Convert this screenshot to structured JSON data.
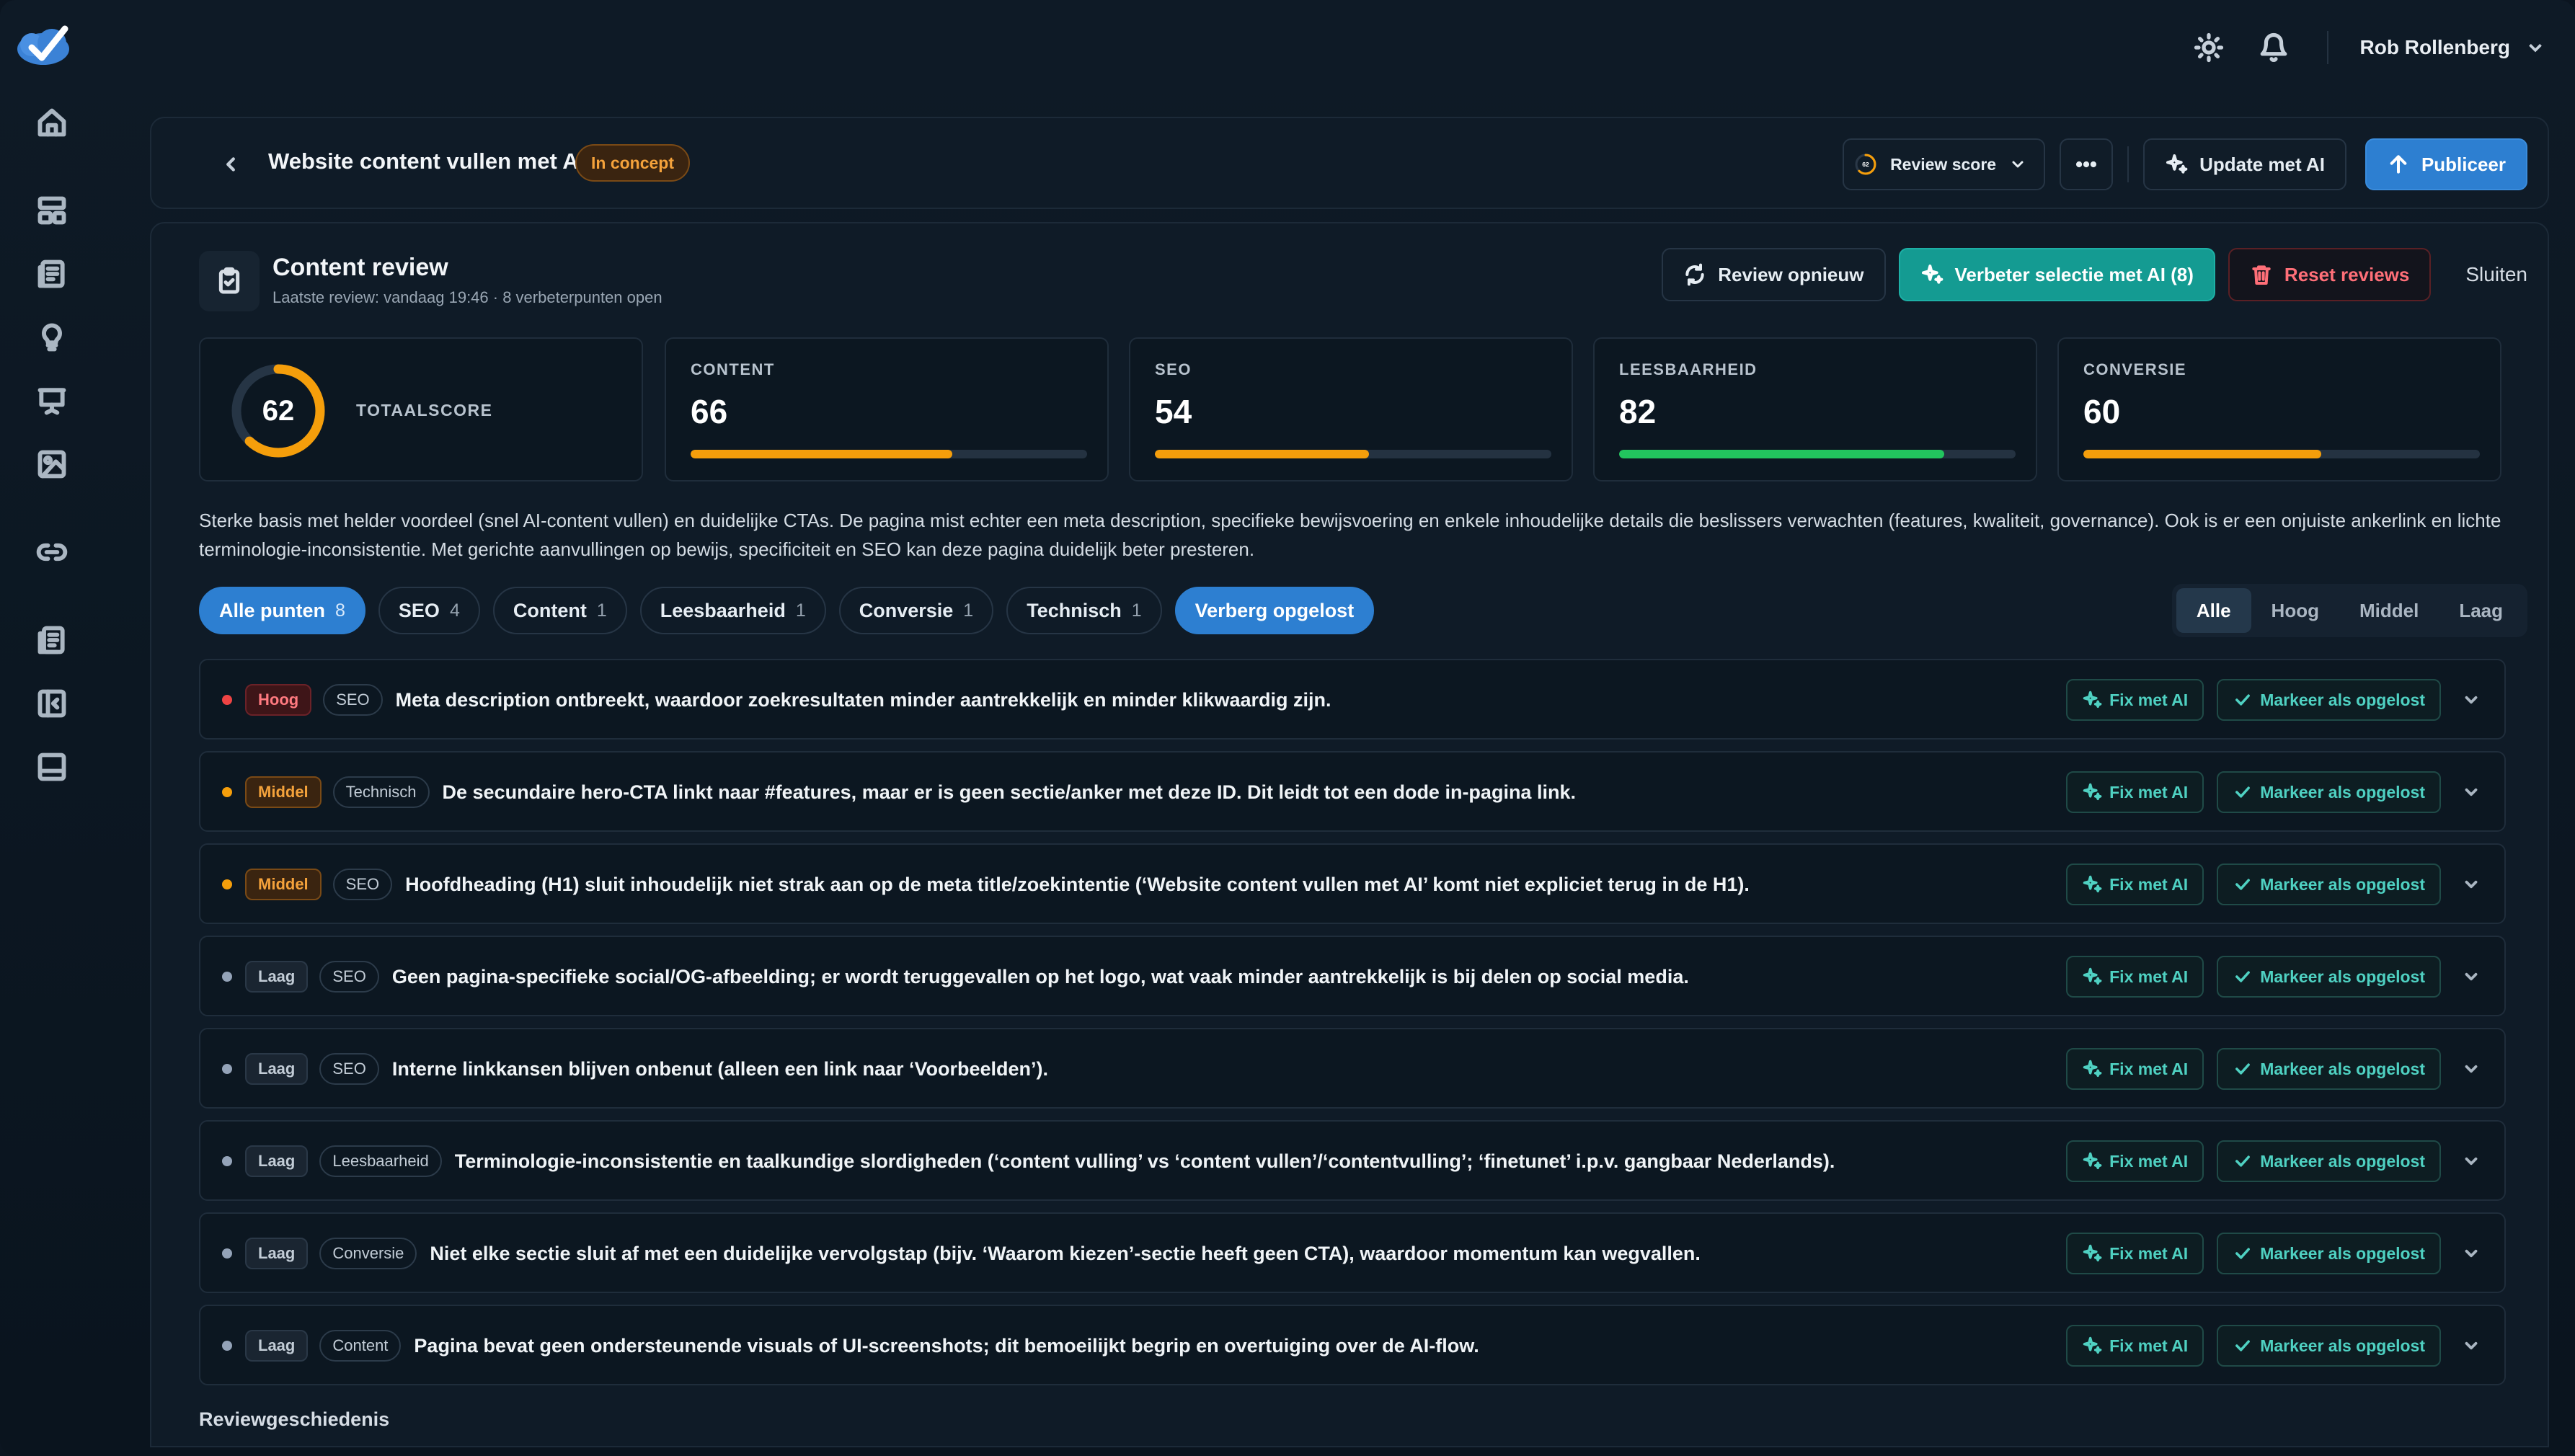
{
  "topbar": {
    "user_name": "Rob Rollenberg",
    "icons": [
      "theme-toggle-icon",
      "bell-icon",
      "chevron-down-icon"
    ]
  },
  "sidebar": {
    "items": [
      "home-icon",
      "layout-icon",
      "pages-icon",
      "lightbulb-icon",
      "presentation-icon",
      "image-icon",
      "link-icon",
      "document-list-icon",
      "sidebar-panel-icon",
      "panel-bottom-icon"
    ]
  },
  "header": {
    "title": "Website content vullen met AI",
    "status": "In concept",
    "review_score_value": "62",
    "review_score_label": "Review score",
    "update_ai_label": "Update met AI",
    "publish_label": "Publiceer"
  },
  "review": {
    "title": "Content review",
    "subtitle": "Laatste review: vandaag 19:46 · 8 verbeterpunten open",
    "review_again_label": "Review opnieuw",
    "improve_label": "Verbeter selectie met AI (8)",
    "reset_label": "Reset reviews",
    "close_label": "Sluiten",
    "total_score": "62",
    "total_score_fraction": 0.62,
    "total_label": "TOTAALSCORE",
    "categories": [
      {
        "label": "CONTENT",
        "value": "66",
        "fraction": 0.66,
        "color": "#f59e0b"
      },
      {
        "label": "SEO",
        "value": "54",
        "fraction": 0.54,
        "color": "#f59e0b"
      },
      {
        "label": "LEESBAARHEID",
        "value": "82",
        "fraction": 0.82,
        "color": "#22c55e"
      },
      {
        "label": "CONVERSIE",
        "value": "60",
        "fraction": 0.6,
        "color": "#f59e0b"
      }
    ],
    "summary": "Sterke basis met helder voordeel (snel AI-content vullen) en duidelijke CTAs. De pagina mist echter een meta description, specifieke bewijsvoering en enkele inhoudelijke details die beslissers verwachten (features, kwaliteit, governance). Ook is er een onjuiste ankerlink en lichte terminologie-inconsistentie. Met gerichte aanvullingen op bewijs, specificiteit en SEO kan deze pagina duidelijk beter presteren.",
    "filters": [
      {
        "label": "Alle punten",
        "count": "8"
      },
      {
        "label": "SEO",
        "count": "4"
      },
      {
        "label": "Content",
        "count": "1"
      },
      {
        "label": "Leesbaarheid",
        "count": "1"
      },
      {
        "label": "Conversie",
        "count": "1"
      },
      {
        "label": "Technisch",
        "count": "1"
      }
    ],
    "hide_resolved_label": "Verberg opgelost",
    "severity_tabs": [
      "Alle",
      "Hoog",
      "Middel",
      "Laag"
    ],
    "fix_label": "Fix met AI",
    "resolve_label": "Markeer als opgelost",
    "issues": [
      {
        "priority": "Hoog",
        "category": "SEO",
        "text": "Meta description ontbreekt, waardoor zoekresultaten minder aantrekkelijk en minder klikwaardig zijn."
      },
      {
        "priority": "Middel",
        "category": "Technisch",
        "text": "De secundaire hero-CTA linkt naar #features, maar er is geen sectie/anker met deze ID. Dit leidt tot een dode in-pagina link."
      },
      {
        "priority": "Middel",
        "category": "SEO",
        "text": "Hoofdheading (H1) sluit inhoudelijk niet strak aan op de meta title/zoekintentie (‘Website content vullen met AI’ komt niet expliciet terug in de H1)."
      },
      {
        "priority": "Laag",
        "category": "SEO",
        "text": "Geen pagina-specifieke social/OG-afbeelding; er wordt teruggevallen op het logo, wat vaak minder aantrekkelijk is bij delen op social media."
      },
      {
        "priority": "Laag",
        "category": "SEO",
        "text": "Interne linkkansen blijven onbenut (alleen een link naar ‘Voorbeelden’)."
      },
      {
        "priority": "Laag",
        "category": "Leesbaarheid",
        "text": "Terminologie-inconsistentie en taalkundige slordigheden (‘content vulling’ vs ‘content vullen’/‘contentvulling’; ‘finetunet’ i.p.v. gangbaar Nederlands)."
      },
      {
        "priority": "Laag",
        "category": "Conversie",
        "text": "Niet elke sectie sluit af met een duidelijke vervolgstap (bijv. ‘Waarom kiezen’-sectie heeft geen CTA), waardoor momentum kan wegvallen."
      },
      {
        "priority": "Laag",
        "category": "Content",
        "text": "Pagina bevat geen ondersteunende visuals of UI-screenshots; dit bemoeilijkt begrip en overtuiging over de AI-flow."
      }
    ],
    "history_label": "Reviewgeschiedenis"
  },
  "colors": {
    "accent_blue": "#2d7fd1",
    "accent_teal": "#149b92",
    "high": "#ef4444",
    "medium": "#f59e0b",
    "low": "#94a3b8"
  }
}
